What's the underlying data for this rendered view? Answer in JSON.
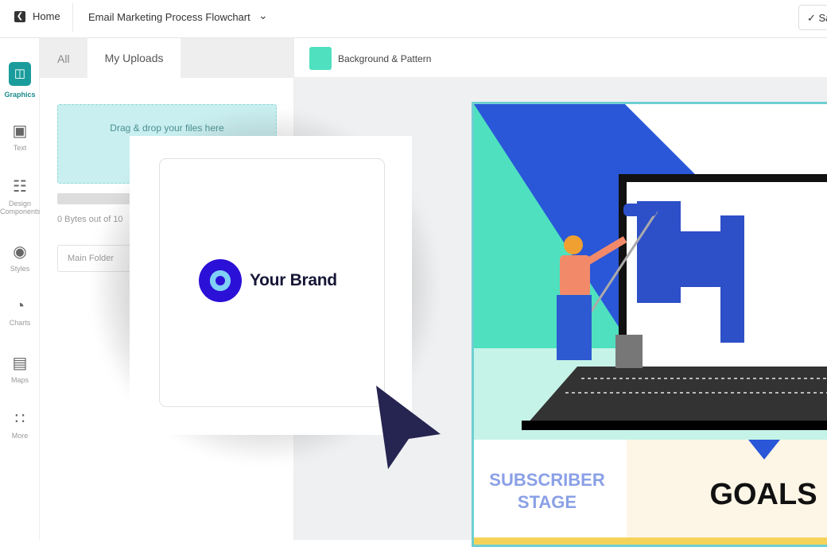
{
  "topbar": {
    "home_label": "Home",
    "document_title": "Email Marketing Process Flowchart",
    "save_label": "✓ Save"
  },
  "sidebar": {
    "items": [
      {
        "label": "Graphics",
        "icon": "graphics-icon",
        "active": true
      },
      {
        "label": "Text",
        "icon": "text-icon"
      },
      {
        "label": "Design Components",
        "icon": "components-icon"
      },
      {
        "label": "Styles",
        "icon": "palette-icon"
      },
      {
        "label": "Charts",
        "icon": "chart-icon"
      },
      {
        "label": "Maps",
        "icon": "map-icon"
      },
      {
        "label": "More",
        "icon": "grid-icon"
      }
    ]
  },
  "panel": {
    "tabs": [
      {
        "label": "All"
      },
      {
        "label": "My Uploads",
        "active": true
      }
    ],
    "dropzone_text": "Drag & drop your files here",
    "storage_text": "0 Bytes out of 10",
    "folder_select": "Main Folder"
  },
  "canvas_toolbar": {
    "background_label": "Background & Pattern",
    "swatch_color": "#4fe0c0"
  },
  "canvas": {
    "stage_label_line1": "SUBSCRIBER",
    "stage_label_line2": "STAGE",
    "goals_label": "GOALS"
  },
  "brand_card": {
    "brand_name": "Your Brand",
    "logo_color": "#2b10d8"
  },
  "colors": {
    "accent": "#1b9c9c",
    "blue": "#2a56d8",
    "teal": "#4fe0c0",
    "cursor": "#262450"
  }
}
